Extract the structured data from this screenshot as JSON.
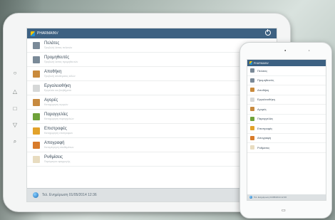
{
  "app_title": "PHARMAINV",
  "tablet": {
    "items": [
      {
        "label": "Πελάτες",
        "sub": "Προβολή λίστας πελατών",
        "icon": "clients-icon",
        "color": "#7a8a98"
      },
      {
        "label": "Προμηθευτές",
        "sub": "Προβολή λίστας προμηθευτών",
        "icon": "suppliers-icon",
        "color": "#7a8a98"
      },
      {
        "label": "Αποθήκη",
        "sub": "Προβολή αποθέματος ειδών",
        "icon": "warehouse-icon",
        "color": "#c98a3b"
      },
      {
        "label": "Εργαλειοθήκη",
        "sub": "Εργαλεία και βοηθήματα",
        "icon": "toolbox-icon",
        "color": "#d6d8d8"
      },
      {
        "label": "Αγορές",
        "sub": "Καταχώρηση αγορών",
        "icon": "purchases-icon",
        "color": "#c78a3f"
      },
      {
        "label": "Παραγγελίες",
        "sub": "Καταχώρηση παραγγελιών",
        "icon": "orders-icon",
        "color": "#6fa23a"
      },
      {
        "label": "Επιστροφές",
        "sub": "Καταχώρηση επιστροφών",
        "icon": "returns-icon",
        "color": "#e2a22a"
      },
      {
        "label": "Απογραφή",
        "sub": "Καταμέτρηση αποθεμάτων",
        "icon": "inventory-icon",
        "color": "#d87b2a"
      },
      {
        "label": "Ρυθμίσεις",
        "sub": "Παράμετροι εφαρμογής",
        "icon": "settings-icon",
        "color": "#e8dcc0"
      }
    ],
    "footer": "Τελ. Ενημέρωση 01/05/2014 12:36"
  },
  "phone": {
    "items": [
      {
        "label": "Πελάτες",
        "color": "#7a8a98"
      },
      {
        "label": "Προμηθευτές",
        "color": "#7a8a98"
      },
      {
        "label": "Αποθήκη",
        "color": "#c98a3b"
      },
      {
        "label": "Εργαλειοθήκη",
        "color": "#d6d8d8"
      },
      {
        "label": "Αγορές",
        "color": "#c78a3f"
      },
      {
        "label": "Παραγγελίες",
        "color": "#6fa23a"
      },
      {
        "label": "Επιστροφές",
        "color": "#e2a22a"
      },
      {
        "label": "Απογραφή",
        "color": "#d87b2a"
      },
      {
        "label": "Ρυθμίσεις",
        "color": "#e8dcc0"
      }
    ],
    "footer": "Τελ. Ενημέρωση 01/05/2014 12:36"
  },
  "colors": {
    "appbar": "#3d6182",
    "footer": "#dde1e3"
  }
}
